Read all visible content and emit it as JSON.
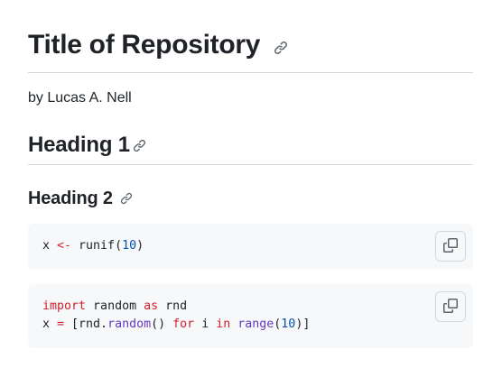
{
  "readme": {
    "title": "Title of Repository",
    "author_line": "by Lucas A. Nell",
    "heading1": "Heading 1",
    "heading2": "Heading 2"
  },
  "code_blocks": [
    {
      "lines": [
        [
          {
            "text": "x ",
            "kind": "plain"
          },
          {
            "text": "<-",
            "kind": "op"
          },
          {
            "text": " runif(",
            "kind": "plain"
          },
          {
            "text": "10",
            "kind": "num"
          },
          {
            "text": ")",
            "kind": "plain"
          }
        ]
      ]
    },
    {
      "lines": [
        [
          {
            "text": "import",
            "kind": "kw"
          },
          {
            "text": " random ",
            "kind": "plain"
          },
          {
            "text": "as",
            "kind": "kw"
          },
          {
            "text": " rnd",
            "kind": "plain"
          }
        ],
        [
          {
            "text": "x ",
            "kind": "plain"
          },
          {
            "text": "=",
            "kind": "op"
          },
          {
            "text": " [rnd.",
            "kind": "plain"
          },
          {
            "text": "random",
            "kind": "fn"
          },
          {
            "text": "() ",
            "kind": "plain"
          },
          {
            "text": "for",
            "kind": "kw"
          },
          {
            "text": " i ",
            "kind": "plain"
          },
          {
            "text": "in",
            "kind": "kw"
          },
          {
            "text": " ",
            "kind": "plain"
          },
          {
            "text": "range",
            "kind": "fn"
          },
          {
            "text": "(",
            "kind": "plain"
          },
          {
            "text": "10",
            "kind": "num"
          },
          {
            "text": ")]",
            "kind": "plain"
          }
        ]
      ]
    }
  ],
  "icons": {
    "anchor": "link-icon",
    "copy": "copy-icon"
  },
  "colors": {
    "text": "#1f2328",
    "border": "#d1d9e0",
    "code_bg": "#f6f8fa",
    "keyword": "#cf222e",
    "number": "#0550ae",
    "function": "#6639ba",
    "icon": "#59636e"
  }
}
